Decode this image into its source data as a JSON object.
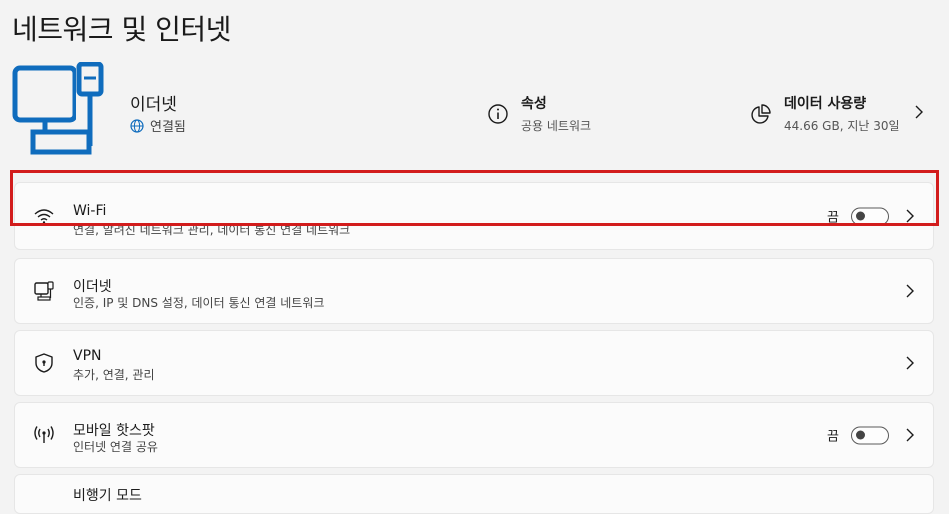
{
  "page": {
    "title": "네트워크 및 인터넷"
  },
  "header": {
    "connection_name": "이더넷",
    "connection_status": "연결됨",
    "properties": {
      "title": "속성",
      "subtitle": "공용 네트워크"
    },
    "data_usage": {
      "title": "데이터 사용량",
      "subtitle": "44.66 GB, 지난 30일"
    }
  },
  "items": [
    {
      "title": "Wi-Fi",
      "desc": "연결, 알려진 네트워크 관리, 데이터 통신 연결 네트워크",
      "toggle_label": "끔",
      "toggle_on": false,
      "icon": "wifi-icon"
    },
    {
      "title": "이더넷",
      "desc": "인증, IP 및 DNS 설정, 데이터 통신 연결 네트워크",
      "icon": "ethernet-icon"
    },
    {
      "title": "VPN",
      "desc": "추가, 연결, 관리",
      "icon": "shield-icon"
    },
    {
      "title": "모바일 핫스팟",
      "desc": "인터넷 연결 공유",
      "toggle_label": "끔",
      "toggle_on": false,
      "icon": "hotspot-icon"
    },
    {
      "title": "비행기 모드",
      "icon": "airplane-icon"
    }
  ],
  "colors": {
    "accent": "#0f6cbd",
    "highlight": "#d21c1c",
    "background": "#f3f3f3"
  }
}
